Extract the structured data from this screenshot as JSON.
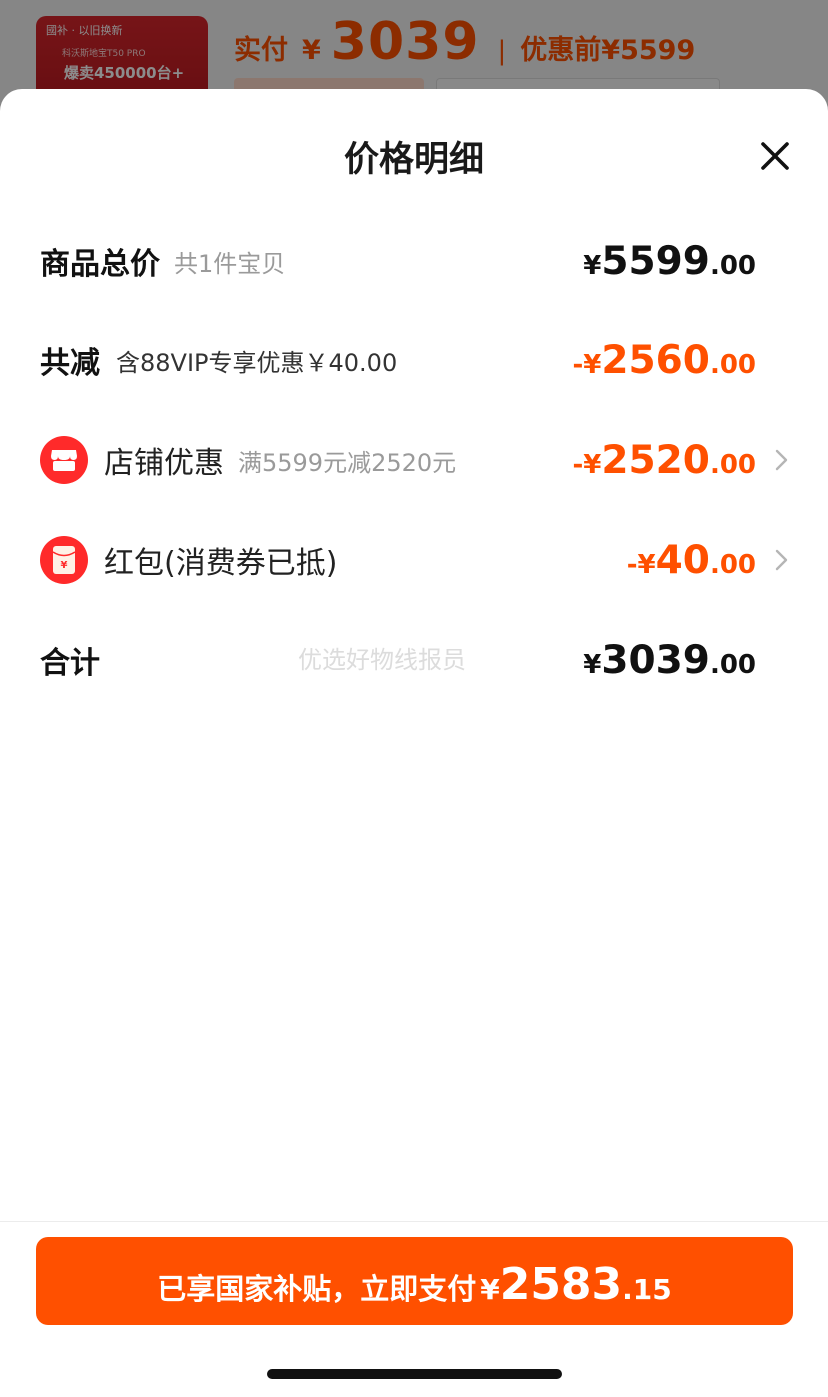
{
  "background_page": {
    "thumbnail": {
      "tag": "國补 · 以旧换新",
      "subtitle": "科沃斯地宝T50 PRO",
      "headline": "爆卖450000台+"
    },
    "paid_label": "实付",
    "currency": "¥",
    "paid_value": "3039",
    "divider": "|",
    "before_discount": "优惠前¥5599"
  },
  "sheet": {
    "title": "价格明细",
    "close_icon": "close-icon"
  },
  "rows": {
    "total": {
      "label": "商品总价",
      "sub": "共1件宝贝",
      "sign": "¥",
      "int": "5599",
      "dec": ".00"
    },
    "reduction": {
      "label": "共减",
      "sub": "含88VIP专享优惠￥40.00",
      "sign": "-¥",
      "int": "2560",
      "dec": ".00"
    },
    "store_discount": {
      "icon": "store-icon",
      "label": "店铺优惠",
      "sub": "满5599元减2520元",
      "sign": "-¥",
      "int": "2520",
      "dec": ".00"
    },
    "red_packet": {
      "icon": "red-packet-icon",
      "label": "红包(消费券已抵)",
      "sign": "-¥",
      "int": "40",
      "dec": ".00"
    },
    "sum": {
      "label": "合计",
      "sign": "¥",
      "int": "3039",
      "dec": ".00"
    }
  },
  "watermark": "优选好物线报员",
  "pay_button": {
    "text": "已享国家补贴，立即支付",
    "sign": "¥",
    "int": "2583",
    "dec": ".15"
  },
  "colors": {
    "accent": "#ff5000",
    "icon_red": "#ff2a2a",
    "text_dark": "#111111",
    "text_gray": "#9a9a9a"
  }
}
